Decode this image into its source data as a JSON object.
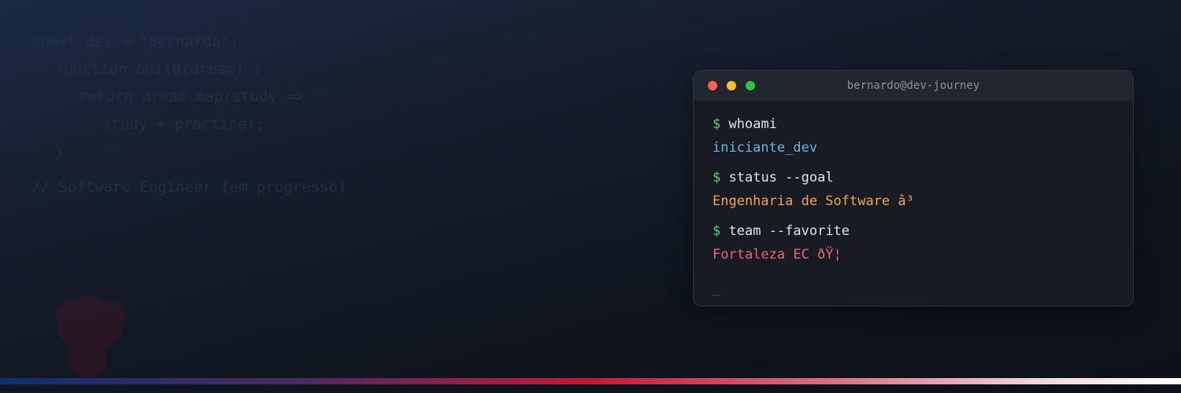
{
  "background_code": {
    "lines": [
      "const dev = \"Bernardo\";",
      "function build(dream) {",
      "return dream.map(study =>",
      "study + practice);",
      "}"
    ],
    "comment": "// Software Engineer (em progresso)"
  },
  "terminal": {
    "title": "bernardo@dev-journey",
    "prompt_symbol": "$",
    "entries": [
      {
        "command": "whoami",
        "output": "iniciante_dev"
      },
      {
        "command": "status --goal",
        "output": "Engenharia de Software â³"
      },
      {
        "command": "team --favorite",
        "output": "Fortaleza EC ðŸ¦"
      }
    ],
    "cursor": "_"
  },
  "colors": {
    "prompt": "#5dd16b",
    "output_blue": "#6db3ea",
    "output_orange": "#f1a552",
    "output_red": "#e4697a",
    "window_close": "#fe5f57",
    "window_minimize": "#febc2e",
    "window_maximize": "#28c840",
    "accent_start": "#0f2f6e",
    "accent_mid": "#c01a36",
    "accent_end": "#ffffff"
  },
  "icons": {
    "background_logo": "lion-mascot-icon"
  }
}
